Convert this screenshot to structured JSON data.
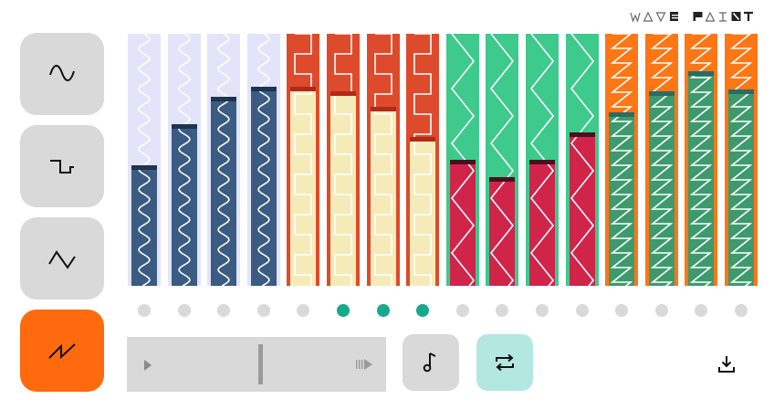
{
  "app": {
    "logo_text": "WAVE PAINT",
    "logo_letters": [
      "W",
      "A",
      "V",
      "E",
      "",
      "P",
      "A",
      "I",
      "N",
      "T"
    ]
  },
  "waveforms": [
    {
      "name": "sine",
      "icon": "sine-wave-icon",
      "active": false
    },
    {
      "name": "square",
      "icon": "square-wave-icon",
      "active": false
    },
    {
      "name": "triangle",
      "icon": "triangle-wave-icon",
      "active": false
    },
    {
      "name": "sawtooth",
      "icon": "sawtooth-wave-icon",
      "active": true
    }
  ],
  "colors": {
    "accent": "#ff6a0e",
    "button_gray": "#d9d9d9",
    "dot_active": "#17a98a",
    "loop_active": "#b3e8e0",
    "sine_bg": "#e2e4fa",
    "sine_fill": "#3a5b82",
    "sine_cap": "#1d3550",
    "square_bg": "#de4a2c",
    "square_fill": "#f5ebb8",
    "square_cap": "#b02a18",
    "triangle_bg": "#3ec98d",
    "triangle_fill": "#d1244b",
    "triangle_cap": "#4a1020",
    "saw_bg": "#ff7615",
    "saw_fill": "#3d9a6d",
    "saw_cap": "#2a6b65"
  },
  "steps": [
    {
      "wave": "sine",
      "level": 0.48
    },
    {
      "wave": "sine",
      "level": 0.64
    },
    {
      "wave": "sine",
      "level": 0.75
    },
    {
      "wave": "sine",
      "level": 0.79
    },
    {
      "wave": "square",
      "level": 0.79
    },
    {
      "wave": "square",
      "level": 0.77
    },
    {
      "wave": "square",
      "level": 0.71
    },
    {
      "wave": "square",
      "level": 0.59
    },
    {
      "wave": "triangle",
      "level": 0.5
    },
    {
      "wave": "triangle",
      "level": 0.43
    },
    {
      "wave": "triangle",
      "level": 0.5
    },
    {
      "wave": "triangle",
      "level": 0.61
    },
    {
      "wave": "sawtooth",
      "level": 0.69
    },
    {
      "wave": "sawtooth",
      "level": 0.77
    },
    {
      "wave": "sawtooth",
      "level": 0.85
    },
    {
      "wave": "sawtooth",
      "level": 0.78
    }
  ],
  "step_dots": [
    false,
    false,
    false,
    false,
    false,
    true,
    true,
    true,
    false,
    false,
    false,
    false,
    false,
    false,
    false,
    false
  ],
  "transport": {
    "play_icon": "play-icon",
    "end_icon": "skip-to-end-icon",
    "position": 0.5
  },
  "controls": {
    "note_icon": "music-note-icon",
    "loop_icon": "loop-icon",
    "loop_active": true,
    "download_icon": "download-icon"
  }
}
